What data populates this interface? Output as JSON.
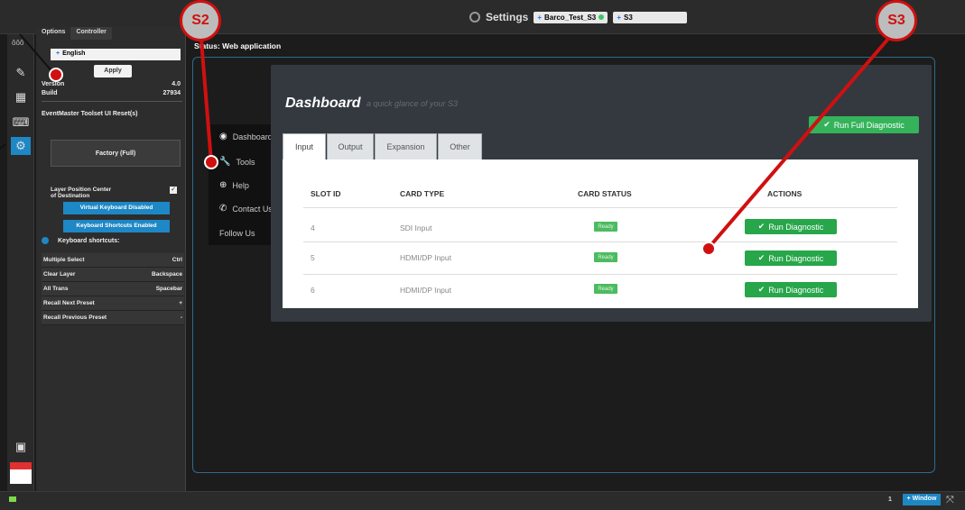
{
  "topbar": {
    "title": "Settings",
    "chip1": "Barco_Test_S3",
    "chip2": "S3"
  },
  "options": {
    "tab_options": "Options",
    "tab_controller": "Controller",
    "language": "English",
    "apply": "Apply",
    "version_label": "Version",
    "version_value": "4.0",
    "build_label": "Build",
    "build_value": "27934",
    "reset_label": "EventMaster Toolset UI Reset(s)",
    "factory": "Factory (Full)",
    "layer_position_1": "Layer Position Center",
    "layer_position_2": "of Destination",
    "vk_btn": "Virtual Keyboard Disabled",
    "ks_btn": "Keyboard Shortcuts Enabled",
    "ks_title": "Keyboard shortcuts:",
    "shortcuts": [
      {
        "action": "Multiple Select",
        "key": "Ctrl"
      },
      {
        "action": "Clear Layer",
        "key": "Backspace"
      },
      {
        "action": "All Trans",
        "key": "Spacebar"
      },
      {
        "action": "Recall Next Preset",
        "key": "+"
      },
      {
        "action": "Recall Previous Preset",
        "key": "-"
      }
    ]
  },
  "main": {
    "status": "Status: Web application",
    "menu": [
      "Dashboard",
      "Tools",
      "Help",
      "Contact Us",
      "Follow Us"
    ],
    "dash_title": "Dashboard",
    "dash_sub": "a quick glance of your S3",
    "run_full": "Run Full Diagnostic",
    "tabs": [
      "Input",
      "Output",
      "Expansion",
      "Other"
    ],
    "headers": [
      "SLOT ID",
      "CARD TYPE",
      "CARD STATUS",
      "ACTIONS"
    ],
    "rows": [
      {
        "slot": "4",
        "type": "SDI Input",
        "status": "Ready",
        "action": "Run Diagnostic"
      },
      {
        "slot": "5",
        "type": "HDMI/DP Input",
        "status": "Ready",
        "action": "Run Diagnostic"
      },
      {
        "slot": "6",
        "type": "HDMI/DP Input",
        "status": "Ready",
        "action": "Run Diagnostic"
      }
    ]
  },
  "bottom": {
    "count": "1",
    "window": "+ Window"
  },
  "callouts": {
    "s2": "S2",
    "s3": "S3"
  },
  "colors": {
    "accent": "#1e87c5",
    "success": "#27a64a",
    "callout": "#d01010"
  }
}
